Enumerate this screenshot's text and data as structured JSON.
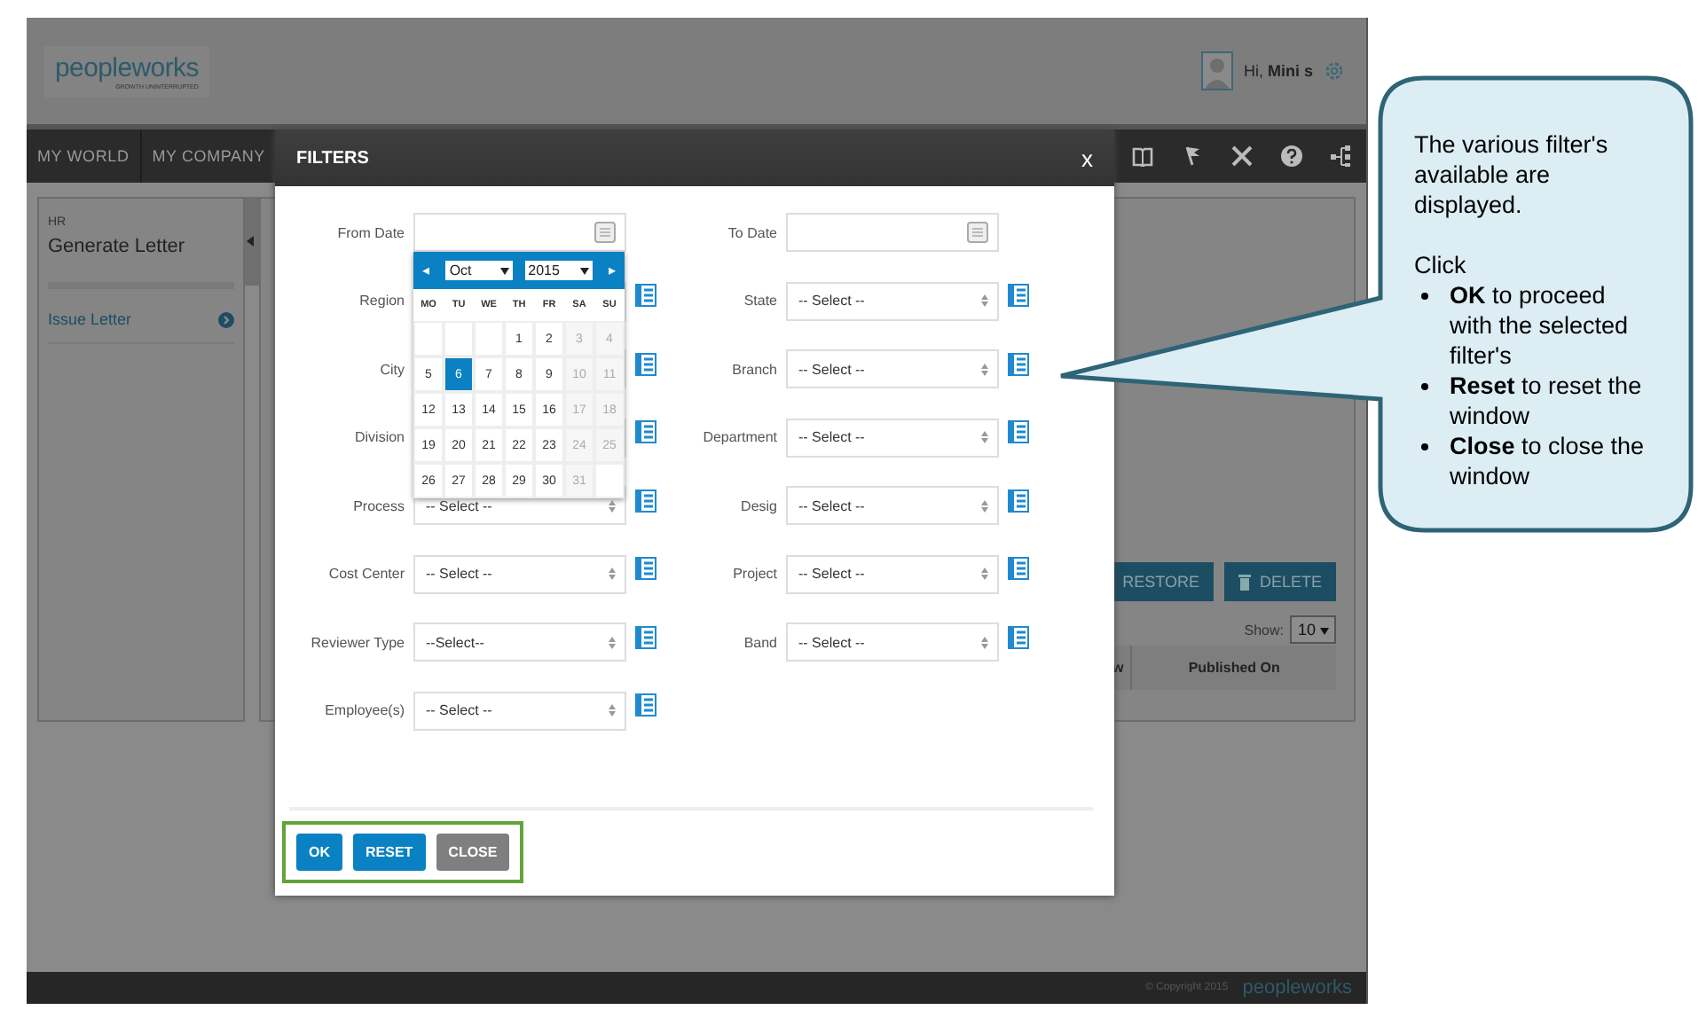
{
  "header": {
    "logo": "peopleworks",
    "tagline": "GROWTH UNINTERRUPTED",
    "greeting": "Hi, **Mini s**"
  },
  "nav": {
    "items": [
      {
        "label": "MY WORLD"
      },
      {
        "label": "MY COMPANY"
      }
    ],
    "icons": [
      {
        "kind": "book"
      },
      {
        "kind": "flag"
      },
      {
        "kind": "tools"
      },
      {
        "kind": "help"
      },
      {
        "kind": "sitemap"
      }
    ]
  },
  "sidebar": {
    "section": "HR",
    "title": "Generate Letter",
    "items": [
      {
        "label": "Issue Letter"
      }
    ]
  },
  "main": {
    "buttons": [
      {
        "label": "RESTORE",
        "kind": "plain"
      },
      {
        "label": "DELETE",
        "kind": "trash"
      }
    ],
    "show_label": "Show:",
    "page_size": "10",
    "columns": [
      {
        "label": "w"
      },
      {
        "label": "Published On"
      }
    ]
  },
  "footer": {
    "copyright": "© Copyright 2015",
    "logo": "peopleworks"
  },
  "modal": {
    "title": "FILTERS",
    "close": "x",
    "left_fields": [
      {
        "label": "From Date",
        "kind": "date"
      },
      {
        "label": "Region",
        "kind": "select"
      },
      {
        "label": "City",
        "kind": "select"
      },
      {
        "label": "Division",
        "kind": "select"
      },
      {
        "label": "Process",
        "kind": "select",
        "value": "-- Select --"
      },
      {
        "label": "Cost Center",
        "kind": "select",
        "value": "-- Select --"
      },
      {
        "label": "Reviewer Type",
        "kind": "select",
        "value": "--Select--"
      },
      {
        "label": "Employee(s)",
        "kind": "select",
        "value": "-- Select --"
      }
    ],
    "right_fields": [
      {
        "label": "To Date",
        "kind": "date"
      },
      {
        "label": "State",
        "kind": "select",
        "value": "-- Select --"
      },
      {
        "label": "Branch",
        "kind": "select",
        "value": "-- Select --"
      },
      {
        "label": "Department",
        "kind": "select",
        "value": "-- Select --"
      },
      {
        "label": "Desig",
        "kind": "select",
        "value": "-- Select --"
      },
      {
        "label": "Project",
        "kind": "select",
        "value": "-- Select --"
      },
      {
        "label": "Band",
        "kind": "select",
        "value": "-- Select --"
      }
    ],
    "calendar": {
      "prev": "◂",
      "next": "▸",
      "month": "Oct",
      "year": "2015",
      "weekdays": [
        "MO",
        "TU",
        "WE",
        "TH",
        "FR",
        "SA",
        "SU"
      ],
      "weeks": [
        [
          {
            "kind": "empty"
          },
          {
            "kind": "empty"
          },
          {
            "kind": "empty"
          },
          {
            "kind": "day",
            "day": "1",
            "weekend": false,
            "selected": false
          },
          {
            "kind": "day",
            "day": "2",
            "weekend": false,
            "selected": false
          },
          {
            "kind": "day",
            "day": "3",
            "weekend": true,
            "selected": false
          },
          {
            "kind": "day",
            "day": "4",
            "weekend": true,
            "selected": false
          }
        ],
        [
          {
            "kind": "day",
            "day": "5",
            "weekend": false,
            "selected": false
          },
          {
            "kind": "day",
            "day": "6",
            "weekend": false,
            "selected": true
          },
          {
            "kind": "day",
            "day": "7",
            "weekend": false,
            "selected": false
          },
          {
            "kind": "day",
            "day": "8",
            "weekend": false,
            "selected": false
          },
          {
            "kind": "day",
            "day": "9",
            "weekend": false,
            "selected": false
          },
          {
            "kind": "day",
            "day": "10",
            "weekend": true,
            "selected": false
          },
          {
            "kind": "day",
            "day": "11",
            "weekend": true,
            "selected": false
          }
        ],
        [
          {
            "kind": "day",
            "day": "12",
            "weekend": false,
            "selected": false
          },
          {
            "kind": "day",
            "day": "13",
            "weekend": false,
            "selected": false
          },
          {
            "kind": "day",
            "day": "14",
            "weekend": false,
            "selected": false
          },
          {
            "kind": "day",
            "day": "15",
            "weekend": false,
            "selected": false
          },
          {
            "kind": "day",
            "day": "16",
            "weekend": false,
            "selected": false
          },
          {
            "kind": "day",
            "day": "17",
            "weekend": true,
            "selected": false
          },
          {
            "kind": "day",
            "day": "18",
            "weekend": true,
            "selected": false
          }
        ],
        [
          {
            "kind": "day",
            "day": "19",
            "weekend": false,
            "selected": false
          },
          {
            "kind": "day",
            "day": "20",
            "weekend": false,
            "selected": false
          },
          {
            "kind": "day",
            "day": "21",
            "weekend": false,
            "selected": false
          },
          {
            "kind": "day",
            "day": "22",
            "weekend": false,
            "selected": false
          },
          {
            "kind": "day",
            "day": "23",
            "weekend": false,
            "selected": false
          },
          {
            "kind": "day",
            "day": "24",
            "weekend": true,
            "selected": false
          },
          {
            "kind": "day",
            "day": "25",
            "weekend": true,
            "selected": false
          }
        ],
        [
          {
            "kind": "day",
            "day": "26",
            "weekend": false,
            "selected": false
          },
          {
            "kind": "day",
            "day": "27",
            "weekend": false,
            "selected": false
          },
          {
            "kind": "day",
            "day": "28",
            "weekend": false,
            "selected": false
          },
          {
            "kind": "day",
            "day": "29",
            "weekend": false,
            "selected": false
          },
          {
            "kind": "day",
            "day": "30",
            "weekend": false,
            "selected": false
          },
          {
            "kind": "day",
            "day": "31",
            "weekend": true,
            "selected": false
          },
          {
            "kind": "empty"
          }
        ]
      ]
    },
    "buttons": [
      {
        "label": "OK",
        "kind": "primary"
      },
      {
        "label": "RESET",
        "kind": "primary"
      },
      {
        "label": "CLOSE",
        "kind": "secondary"
      }
    ]
  },
  "callout": {
    "intro": "The various filter's available are displayed.",
    "lead": "Click",
    "points": [
      "**OK** to proceed with the selected filter's",
      "**Reset** to reset the window",
      "**Close** to close the window"
    ]
  }
}
